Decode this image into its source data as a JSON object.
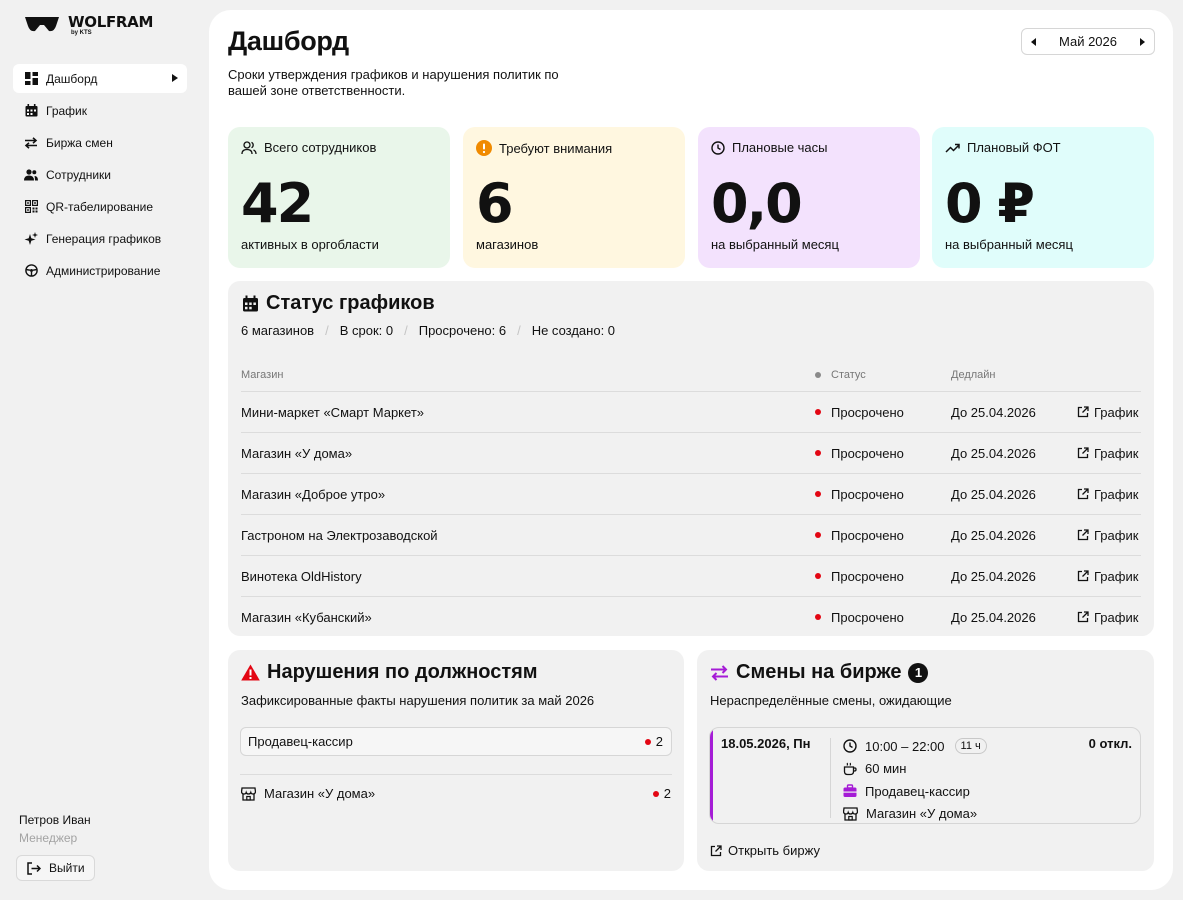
{
  "brand": {
    "name": "WOLFRAM",
    "by": "by KTS"
  },
  "sidebar": {
    "items": [
      {
        "label": "Дашборд",
        "icon": "dashboard-icon",
        "active": true
      },
      {
        "label": "График",
        "icon": "calendar-icon"
      },
      {
        "label": "Биржа смен",
        "icon": "swap-icon"
      },
      {
        "label": "Сотрудники",
        "icon": "users-icon"
      },
      {
        "label": "QR-табелирование",
        "icon": "qr-icon"
      },
      {
        "label": "Генерация графиков",
        "icon": "sparkles-icon"
      },
      {
        "label": "Администрирование",
        "icon": "steering-wheel-icon"
      }
    ]
  },
  "user": {
    "name": "Петров Иван",
    "role": "Менеджер",
    "logout_label": "Выйти"
  },
  "header": {
    "title": "Дашборд",
    "subtitle": "Сроки утверждения графиков и нарушения политик по вашей зоне ответственности.",
    "month": "Май 2026"
  },
  "stats": [
    {
      "label": "Всего сотрудников",
      "value": "42",
      "caption": "активных в оргобласти",
      "icon": "users-icon",
      "color": "#e9f6ea"
    },
    {
      "label": "Требуют внимания",
      "value": "6",
      "caption": "магазинов",
      "icon": "warning-circle-icon",
      "color": "#fff7e0"
    },
    {
      "label": "Плановые часы",
      "value": "0,0",
      "caption": "на выбранный месяц",
      "icon": "clock-icon",
      "color": "#f3e2fd"
    },
    {
      "label": "Плановый ФОТ",
      "value": "0 ₽",
      "caption": "на выбранный месяц",
      "icon": "trend-up-icon",
      "color": "#e0fdfb"
    }
  ],
  "schedule_status": {
    "title": "Статус графиков",
    "summary": [
      "6 магазинов",
      "В срок: 0",
      "Просрочено: 6",
      "Не создано: 0"
    ],
    "columns": {
      "store": "Магазин",
      "status": "Статус",
      "deadline": "Дедлайн"
    },
    "link_label": "График",
    "rows": [
      {
        "store": "Мини-маркет «Смарт Маркет»",
        "status": "Просрочено",
        "deadline": "До 25.04.2026"
      },
      {
        "store": "Магазин «У дома»",
        "status": "Просрочено",
        "deadline": "До 25.04.2026"
      },
      {
        "store": "Магазин «Доброе утро»",
        "status": "Просрочено",
        "deadline": "До 25.04.2026"
      },
      {
        "store": "Гастроном на Электрозаводской",
        "status": "Просрочено",
        "deadline": "До 25.04.2026"
      },
      {
        "store": "Винотека OldHistory",
        "status": "Просрочено",
        "deadline": "До 25.04.2026"
      },
      {
        "store": "Магазин «Кубанский»",
        "status": "Просрочено",
        "deadline": "До 25.04.2026"
      }
    ],
    "status_color": "#e30613"
  },
  "violations": {
    "title": "Нарушения по должностям",
    "subtitle": "Зафиксированные факты нарушения политик за май 2026",
    "role": {
      "label": "Продавец-кассир",
      "count": "2"
    },
    "store": {
      "label": "Магазин «У дома»",
      "count": "2"
    }
  },
  "exchange": {
    "title": "Смены на бирже",
    "badge": "1",
    "subtitle": "Нераспределённые смены, ожидающие",
    "shift": {
      "date": "18.05.2026, Пн",
      "time": "10:00 – 22:00",
      "hours": "11 ч",
      "break": "60 мин",
      "role": "Продавец-кассир",
      "store": "Магазин «У дома»",
      "responses": "0 откл."
    },
    "open_label": "Открыть биржу",
    "accent": "#a51cd6"
  }
}
